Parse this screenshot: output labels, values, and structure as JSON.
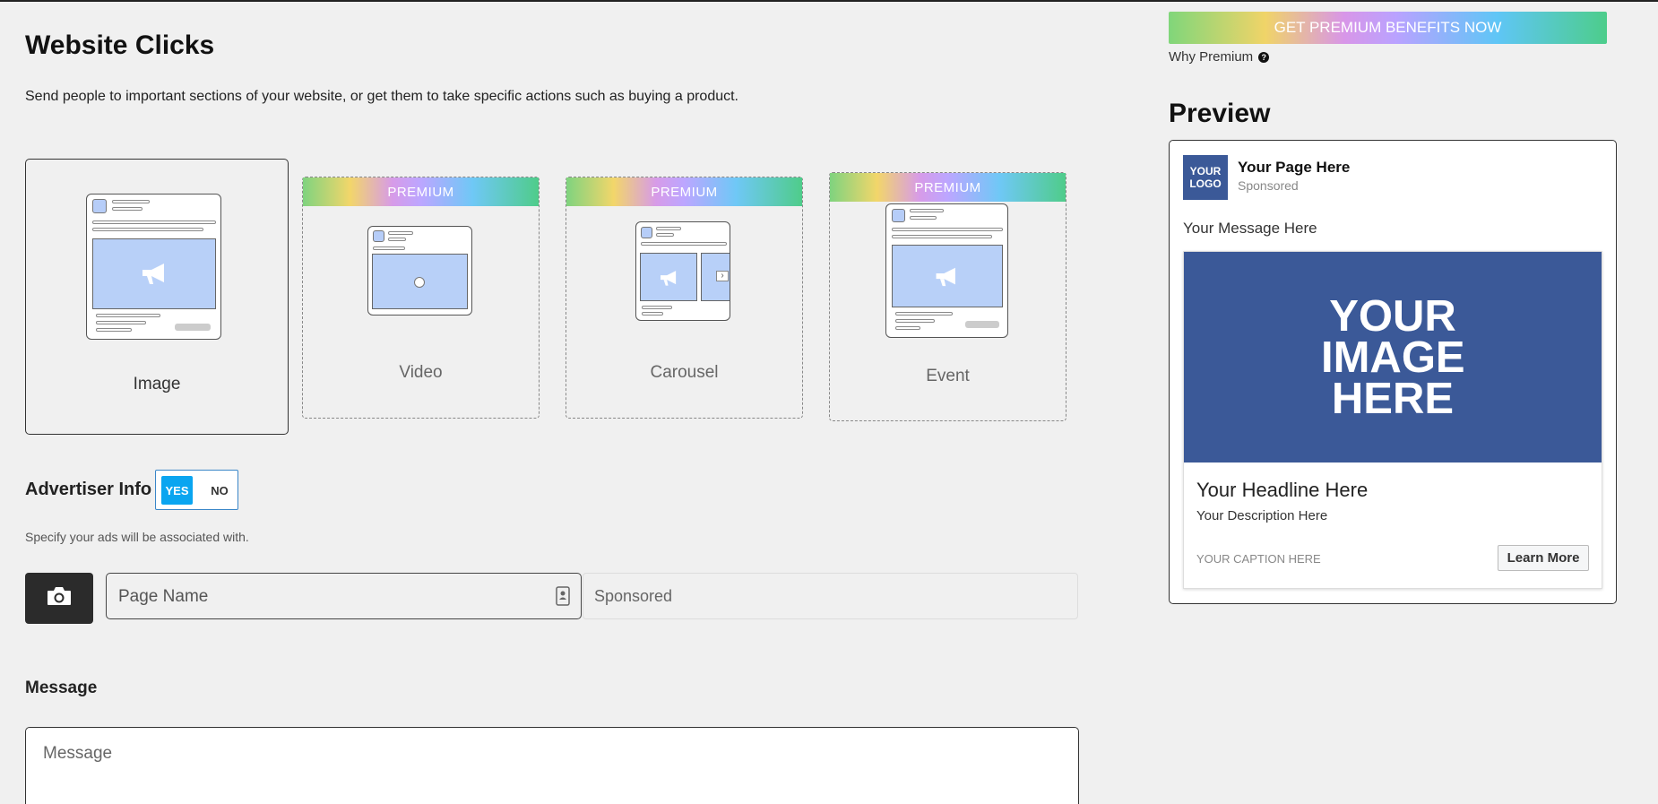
{
  "header": {
    "title": "Website Clicks",
    "description": "Send people to important sections of your website, or get them to take specific actions such as buying a product."
  },
  "formats": [
    {
      "label": "Image",
      "premium": false,
      "selected": true
    },
    {
      "label": "Video",
      "premium": true,
      "badge": "PREMIUM"
    },
    {
      "label": "Carousel",
      "premium": true,
      "badge": "PREMIUM"
    },
    {
      "label": "Event",
      "premium": true,
      "badge": "PREMIUM"
    }
  ],
  "advertiser": {
    "label": "Advertiser Info",
    "toggle_yes": "YES",
    "toggle_no": "NO",
    "toggle_value": "YES",
    "help": "Specify your ads will be associated with.",
    "page_name_placeholder": "Page Name",
    "sponsored_text": "Sponsored"
  },
  "message": {
    "label": "Message",
    "placeholder": "Message"
  },
  "premium": {
    "cta": "GET PREMIUM BENEFITS NOW",
    "why": "Why Premium",
    "why_icon": "?"
  },
  "preview": {
    "title": "Preview",
    "logo_text": "YOUR LOGO",
    "page_name": "Your Page Here",
    "sponsored": "Sponsored",
    "message": "Your Message Here",
    "image_text": "YOUR IMAGE HERE",
    "headline": "Your Headline Here",
    "description": "Your Description Here",
    "caption": "YOUR CAPTION HERE",
    "cta_button": "Learn More"
  },
  "colors": {
    "accent_blue": "#0aa5f0",
    "brand_blue": "#3b5998",
    "dark_button": "#2b2b2b"
  }
}
